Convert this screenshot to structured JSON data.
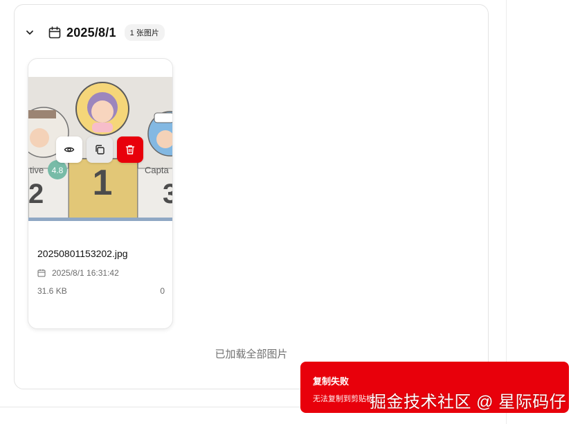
{
  "group": {
    "date": "2025/8/1",
    "count_badge": "1 张图片",
    "icons": {
      "collapse": "chevron-down-icon",
      "calendar": "calendar-icon"
    }
  },
  "image_card": {
    "file_name": "20250801153202.jpg",
    "timestamp": "2025/8/1 16:31:42",
    "file_size": "31.6 KB",
    "counter": "0",
    "thumbnail": {
      "podium_labels": [
        "tive",
        "4.8",
        "1",
        "Capta",
        "2",
        "3"
      ]
    },
    "actions": [
      {
        "name": "view",
        "icon": "eye-icon"
      },
      {
        "name": "copy",
        "icon": "copy-icon"
      },
      {
        "name": "delete",
        "icon": "trash-icon"
      }
    ]
  },
  "footer": {
    "loaded_all": "已加载全部图片"
  },
  "toast": {
    "title": "复制失败",
    "message": "无法复制到剪贴板",
    "color": "#e8000b"
  },
  "watermark": "掘金技术社区 @ 星际码仔"
}
